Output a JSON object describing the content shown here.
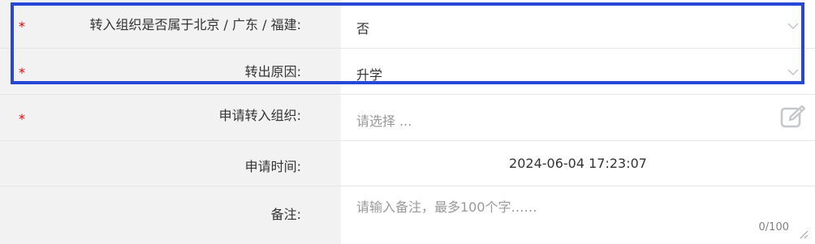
{
  "form": {
    "rows": [
      {
        "required": true,
        "label": "转入组织是否属于北京 / 广东 / 福建:",
        "value": "否",
        "control": "select"
      },
      {
        "required": true,
        "label": "转出原因:",
        "value": "升学",
        "control": "select"
      },
      {
        "required": true,
        "label": "申请转入组织:",
        "placeholder": "请选择 ...",
        "control": "picker"
      },
      {
        "required": false,
        "label": "申请时间:",
        "value": "2024-06-04 17:23:07",
        "control": "readonly"
      },
      {
        "required": false,
        "label": "备注:",
        "placeholder": "请输入备注，最多100个字……",
        "counter": "0/100",
        "control": "textarea"
      }
    ],
    "required_mark": "*"
  },
  "highlight": {
    "color": "#2747d6",
    "covers_rows": [
      0,
      1
    ]
  }
}
